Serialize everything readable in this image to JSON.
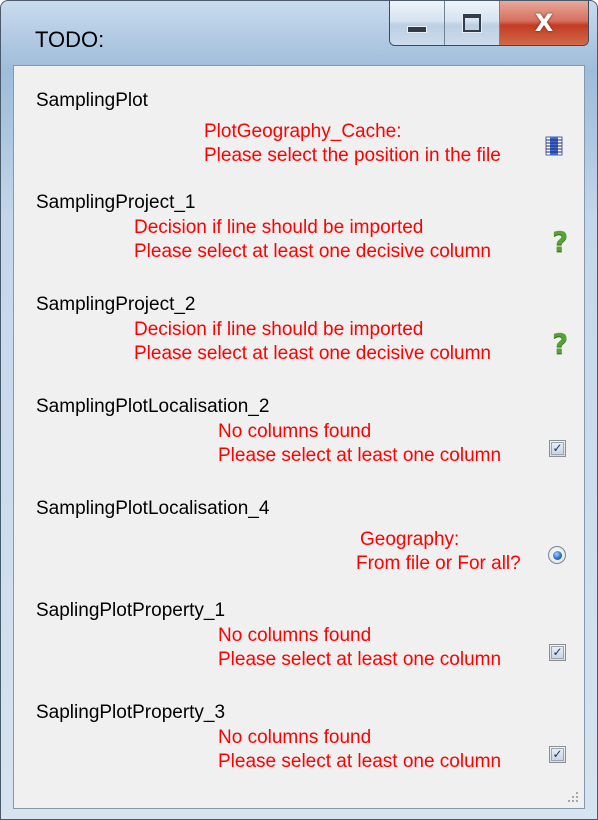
{
  "window": {
    "title": "TODO:",
    "controls": {
      "minimize_icon": "minimize-icon",
      "maximize_icon": "maximize-icon",
      "close_icon": "close-icon",
      "close_glyph": "X"
    }
  },
  "items": [
    {
      "name": "SamplingPlot",
      "line1": "PlotGeography_Cache:",
      "line2": "Please select the position in the file",
      "icon": "column-position-icon"
    },
    {
      "name": "SamplingProject_1",
      "line1": "Decision if line should be imported",
      "line2": "Please select at least one decisive column",
      "icon": "question-icon",
      "glyph": "?"
    },
    {
      "name": "SamplingProject_2",
      "line1": "Decision if line should be imported",
      "line2": "Please select at least one decisive column",
      "icon": "question-icon",
      "glyph": "?"
    },
    {
      "name": "SamplingPlotLocalisation_2",
      "line1": "No columns found",
      "line2": "Please select at least one column",
      "icon": "checkbox-icon",
      "glyph": "✓"
    },
    {
      "name": "SamplingPlotLocalisation_4",
      "line1": "Geography:",
      "line2": "From file or For all?",
      "icon": "radio-button-icon"
    },
    {
      "name": "SaplingPlotProperty_1",
      "line1": "No columns found",
      "line2": "Please select at least one column",
      "icon": "checkbox-icon",
      "glyph": "✓"
    },
    {
      "name": "SaplingPlotProperty_3",
      "line1": "No columns found",
      "line2": "Please select at least one column",
      "icon": "checkbox-icon",
      "glyph": "✓"
    }
  ],
  "colors": {
    "message_text": "#ff0000",
    "question_icon": "#55a332",
    "close_button": "#c43c22"
  }
}
